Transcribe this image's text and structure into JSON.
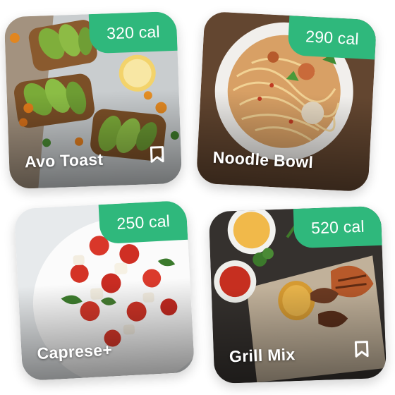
{
  "cards": [
    {
      "title": "Avo Toast",
      "calories": "320 cal",
      "bookmark": true,
      "bookmark_icon": "bookmark-icon",
      "image": "avocado-toast-photo"
    },
    {
      "title": "Noodle Bowl",
      "calories": "290 cal",
      "bookmark": false,
      "image": "noodle-bowl-photo"
    },
    {
      "title": "Caprese+",
      "calories": "250 cal",
      "bookmark": false,
      "image": "caprese-salad-photo"
    },
    {
      "title": "Grill Mix",
      "calories": "520 cal",
      "bookmark": true,
      "bookmark_icon": "bookmark-icon",
      "image": "grilled-meat-photo"
    }
  ],
  "colors": {
    "badge": "#2fb87c",
    "title_text": "#ffffff"
  }
}
